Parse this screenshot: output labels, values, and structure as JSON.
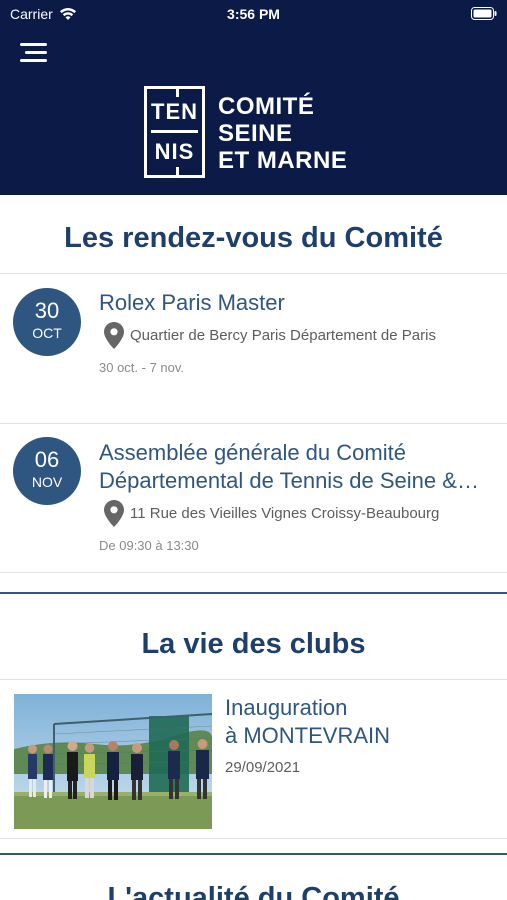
{
  "status_bar": {
    "carrier": "Carrier",
    "time": "3:56 PM"
  },
  "header": {
    "logo_ten": "TEN",
    "logo_nis": "NIS",
    "logo_line1": "COMITÉ",
    "logo_line2": "SEINE",
    "logo_line3": "ET MARNE",
    "background_color": "#0b1a47"
  },
  "rendezvous": {
    "title": "Les rendez-vous du Comité",
    "events": [
      {
        "day": "30",
        "month": "OCT",
        "title_line1": "Rolex Paris Master",
        "title_line2": "",
        "location": "Quartier de Bercy Paris Département de Paris",
        "dates": "30 oct. - 7 nov."
      },
      {
        "day": "06",
        "month": "NOV",
        "title_line1": "Assemblée générale du Comité",
        "title_line2": "Départemental de Tennis de Seine &…",
        "location": "11 Rue des Vieilles Vignes Croissy-Beaubourg",
        "dates": "De 09:30 à 13:30"
      }
    ]
  },
  "clubs": {
    "title": "La vie des clubs",
    "items": [
      {
        "title_line1": "Inauguration",
        "title_line2": "à MONTEVRAIN",
        "date": "29/09/2021",
        "photo": "group-photo-tennis-court"
      }
    ]
  },
  "next_section": {
    "title": "L'actualité du Comité"
  },
  "colors": {
    "accent": "#2f5680",
    "title": "#1f3f6b"
  }
}
